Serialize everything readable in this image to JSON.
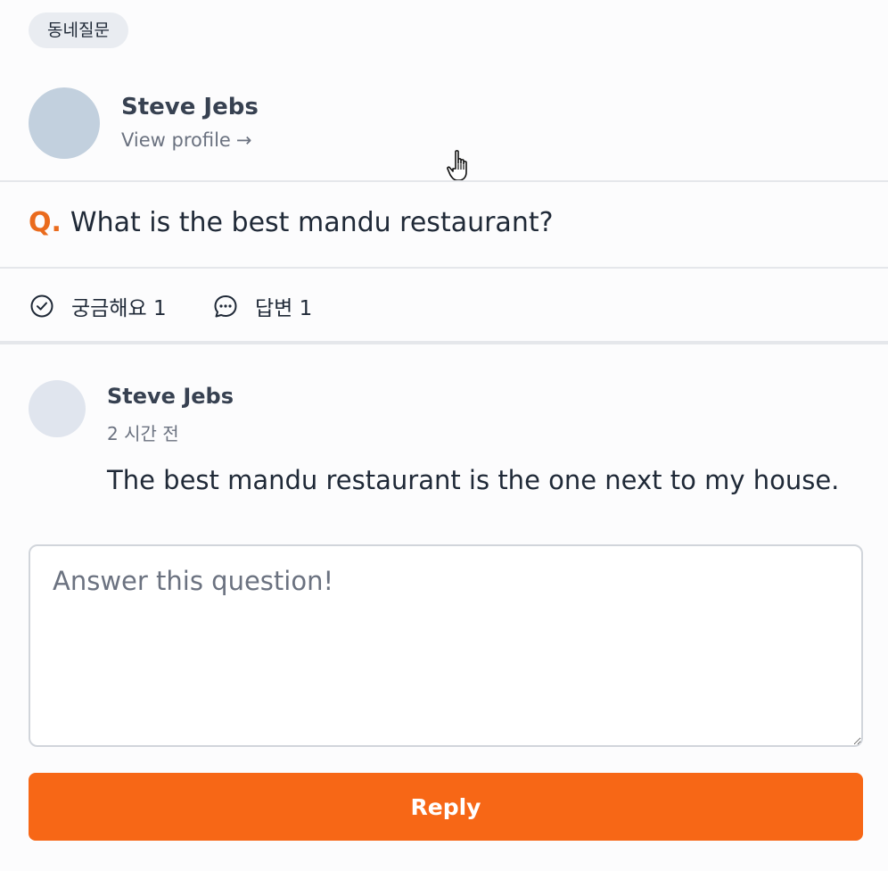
{
  "post": {
    "category": "동네질문",
    "author": {
      "name": "Steve Jebs",
      "profile_link": "View profile",
      "profile_arrow": "→"
    },
    "question": {
      "prefix": "Q.",
      "text": "What is the best mandu restaurant?"
    },
    "stats": {
      "curious_label": "궁금해요 1",
      "curious_icon": "check-circle-icon",
      "answers_label": "답변 1",
      "answers_icon": "chat-bubble-icon"
    }
  },
  "answers": [
    {
      "author": "Steve Jebs",
      "time": "2 시간 전",
      "text": "The best mandu restaurant is the one next to my house."
    }
  ],
  "reply": {
    "value": "",
    "placeholder": "Answer this question!",
    "button_label": "Reply"
  },
  "colors": {
    "accent": "#f76716",
    "question_prefix": "#ea6b1d"
  }
}
